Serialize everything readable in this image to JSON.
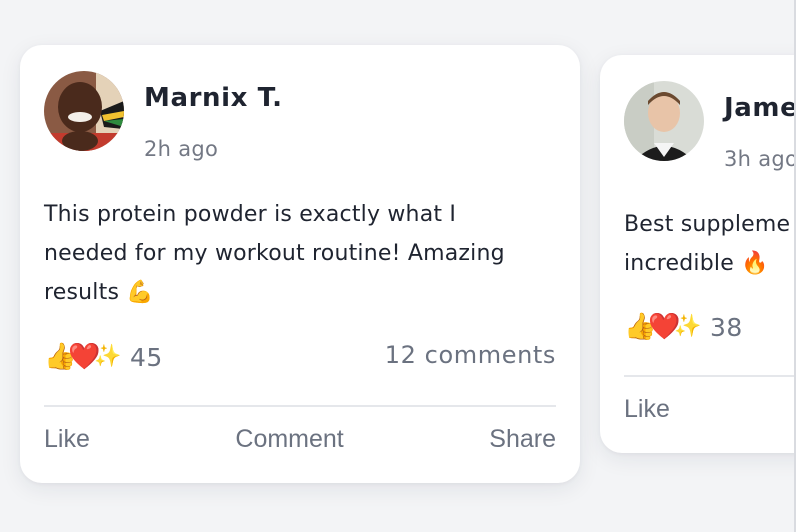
{
  "posts": [
    {
      "author": "Marnix T.",
      "time": "2h ago",
      "text": "This protein powder is exactly what I needed for my workout routine! Amazing results",
      "text_emoji": "💪",
      "reaction_count": "45",
      "comments": "12 comments",
      "actions": {
        "like": "Like",
        "comment": "Comment",
        "share": "Share"
      }
    },
    {
      "author": "Jame",
      "time": "3h ago",
      "text_line1": "Best suppleme",
      "text_line2": "incredible",
      "text_emoji": "🔥",
      "reaction_count": "38",
      "actions": {
        "like": "Like"
      }
    }
  ],
  "reaction_icons": [
    "thumbs-up",
    "heart",
    "sparkles"
  ],
  "colors": {
    "background": "#f3f4f6",
    "card": "#ffffff",
    "primary_text": "#1f2430",
    "secondary_text": "#6b7280",
    "divider": "#e5e7eb"
  }
}
